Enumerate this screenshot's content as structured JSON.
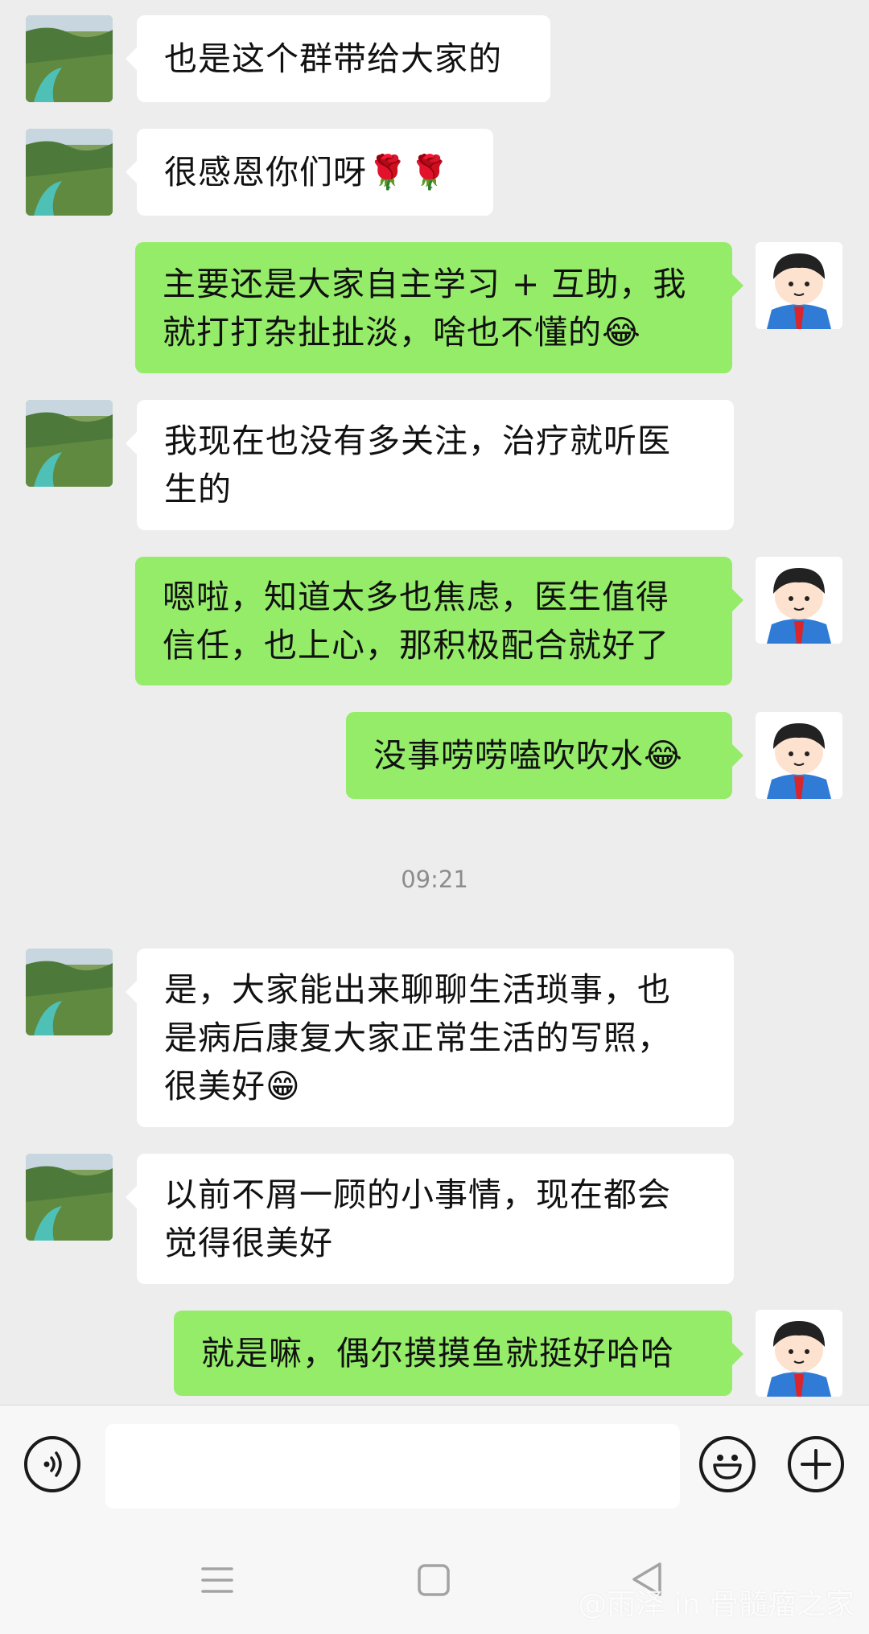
{
  "colors": {
    "background": "#ededed",
    "incoming_bubble": "#ffffff",
    "outgoing_bubble": "#95ec69",
    "timestamp_text": "#8c8c8c"
  },
  "messages": [
    {
      "direction": "in",
      "text": "也是这个群带给大家的"
    },
    {
      "direction": "in",
      "text": "很感恩你们呀🌹🌹"
    },
    {
      "direction": "out",
      "text": "主要还是大家自主学习 + 互助，我\n就打打杂扯扯淡，啥也不懂的😂"
    },
    {
      "direction": "in",
      "text": "我现在也没有多关注，治疗就听医\n生的"
    },
    {
      "direction": "out",
      "text": "嗯啦，知道太多也焦虑，医生值得\n信任，也上心，那积极配合就好了"
    },
    {
      "direction": "out",
      "text": "没事唠唠嗑吹吹水😂"
    },
    {
      "direction": "in",
      "text": "是，大家能出来聊聊生活琐事，也\n是病后康复大家正常生活的写照，\n很美好😁"
    },
    {
      "direction": "in",
      "text": "以前不屑一顾的小事情，现在都会\n觉得很美好"
    },
    {
      "direction": "out",
      "text": "就是嘛，偶尔摸摸鱼就挺好哈哈"
    }
  ],
  "timestamp": "09:21",
  "input_bar": {
    "voice_icon": "voice-icon",
    "emoji_icon": "emoji-icon",
    "plus_icon": "plus-icon",
    "text_value": ""
  },
  "nav_bar": {
    "menu_icon": "menu-icon",
    "home_icon": "home-square-icon",
    "back_icon": "back-triangle-icon"
  },
  "watermark": "@雨泽 in 骨髓瘤之家"
}
